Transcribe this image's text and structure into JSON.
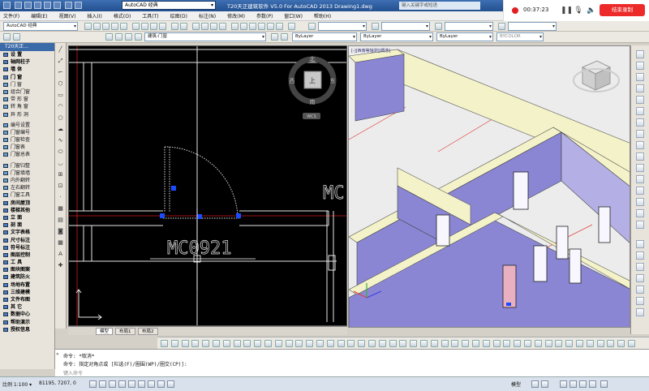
{
  "titlebar": {
    "workspace": "AutoCAD 经典",
    "title": "T20天正建筑软件 V5.0 For AutoCAD 2013    Drawing1.dwg",
    "search_placeholder": "键入关键字或短语"
  },
  "recorder": {
    "time": "00:37:23",
    "stop_label": "结束录制",
    "accent": "#ec2a2a"
  },
  "menubar": {
    "items": [
      "文件(F)",
      "编辑(E)",
      "视图(V)",
      "插入(I)",
      "格式(O)",
      "工具(T)",
      "绘图(D)",
      "标注(N)",
      "修改(M)",
      "参数(P)",
      "窗口(W)",
      "帮助(H)"
    ]
  },
  "toolbar": {
    "workspace_combo": "AutoCAD 经典",
    "layer_combo": "建筑-门窗",
    "color_combo": "ByLayer",
    "linetype_combo": "ByLayer",
    "lineweight_combo": "ByLayer",
    "plotstyle_combo": "BYCOLOR"
  },
  "palette": {
    "title": "T20天正...",
    "items": [
      {
        "label": "设    置",
        "kind": "cat"
      },
      {
        "label": "轴网柱子",
        "kind": "cat"
      },
      {
        "label": "墙    体",
        "kind": "cat"
      },
      {
        "label": "门    窗",
        "kind": "cat"
      },
      {
        "label": "门    窗",
        "kind": "sub"
      },
      {
        "label": "组合门窗",
        "kind": "sub"
      },
      {
        "label": "带 形 窗",
        "kind": "sub"
      },
      {
        "label": "转 角 窗",
        "kind": "sub"
      },
      {
        "label": "异 形 洞",
        "kind": "sub"
      },
      {
        "label": "",
        "kind": "gap"
      },
      {
        "label": "编号设置",
        "kind": "sub"
      },
      {
        "label": "门窗编号",
        "kind": "sub"
      },
      {
        "label": "门窗检查",
        "kind": "sub"
      },
      {
        "label": "门窗表",
        "kind": "sub"
      },
      {
        "label": "门窗总表",
        "kind": "sub"
      },
      {
        "label": "",
        "kind": "gap"
      },
      {
        "label": "门窗归整",
        "kind": "sub"
      },
      {
        "label": "门窗填墙",
        "kind": "sub"
      },
      {
        "label": "内外翻转",
        "kind": "sub"
      },
      {
        "label": "左右翻转",
        "kind": "sub"
      },
      {
        "label": "门窗工具",
        "kind": "sub"
      },
      {
        "label": "房间屋顶",
        "kind": "cat"
      },
      {
        "label": "楼梯其他",
        "kind": "cat"
      },
      {
        "label": "立    面",
        "kind": "cat"
      },
      {
        "label": "剖    面",
        "kind": "cat"
      },
      {
        "label": "文字表格",
        "kind": "cat"
      },
      {
        "label": "尺寸标注",
        "kind": "cat"
      },
      {
        "label": "符号标注",
        "kind": "cat"
      },
      {
        "label": "图层控制",
        "kind": "cat"
      },
      {
        "label": "工    具",
        "kind": "cat"
      },
      {
        "label": "图块图案",
        "kind": "cat"
      },
      {
        "label": "建筑防火",
        "kind": "cat"
      },
      {
        "label": "场地布置",
        "kind": "cat"
      },
      {
        "label": "三维建模",
        "kind": "cat"
      },
      {
        "label": "文件布图",
        "kind": "cat"
      },
      {
        "label": "其    它",
        "kind": "cat"
      },
      {
        "label": "数据中心",
        "kind": "cat"
      },
      {
        "label": "帮助演示",
        "kind": "cat"
      },
      {
        "label": "授权信息",
        "kind": "cat"
      }
    ]
  },
  "viewport2d": {
    "door_label": "MC0921",
    "door_label_partial": "MC",
    "viewcube": {
      "north": "北",
      "south": "南",
      "east": "东",
      "west": "西",
      "face": "上",
      "wcs": "WCS"
    },
    "colors": {
      "bg": "#000000",
      "wall": "#e6e6e6",
      "axis": "#d01c1c",
      "grip": "#1a4cff"
    }
  },
  "viewport3d": {
    "label": "[-][西南等轴测][概念]",
    "colors": {
      "wall": "#8a86d4",
      "top": "#f4f2c8",
      "floor": "#eeeeee",
      "axis": "#e04040"
    }
  },
  "layout_tabs": [
    "模型",
    "布局1",
    "布局2"
  ],
  "command": {
    "history": "命令: *取消*",
    "prompt": "命令: 指定对角点或 [栏选(F)/圈围(WP)/圈交(CP)]:",
    "input_placeholder": "键入命令"
  },
  "status": {
    "scale": "比例 1:100 ▾",
    "coords": "81195, 7207, 0",
    "model": "模型"
  }
}
